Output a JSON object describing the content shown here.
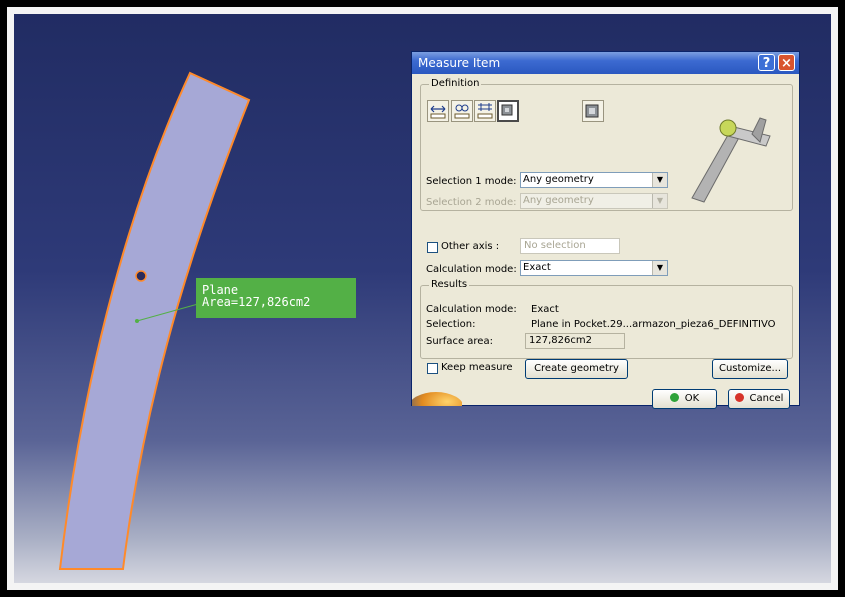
{
  "viewport": {
    "annotation": {
      "line1": "Plane",
      "line2": "Area=127,826cm2"
    },
    "colors": {
      "part_fill": "#a6a8d6",
      "part_edge": "#ff8a2a",
      "callout_bg": "#53b046"
    }
  },
  "dialog": {
    "title": "Measure Item",
    "help_icon": "question-mark",
    "close_icon": "close-x",
    "definition": {
      "legend": "Definition",
      "tool_icons": [
        "measure-between-icon",
        "measure-between-chain-icon",
        "measure-between-fan-icon",
        "measure-item-icon",
        "measure-thickness-icon"
      ],
      "selection1_label": "Selection 1 mode:",
      "selection1_value": "Any geometry",
      "selection2_label": "Selection 2 mode:",
      "selection2_value": "Any geometry",
      "other_axis_label": "Other axis :",
      "other_axis_placeholder": "No selection",
      "calc_label": "Calculation mode:",
      "calc_value": "Exact"
    },
    "results": {
      "legend": "Results",
      "calc_label": "Calculation mode:",
      "calc_value": "Exact",
      "selection_label": "Selection:",
      "selection_value": "Plane in Pocket.29...armazon_pieza6_DEFINITIVO",
      "surface_label": "Surface area:",
      "surface_value": "127,826cm2"
    },
    "keep_measure_label": "Keep measure",
    "create_geometry_label": "Create geometry",
    "customize_label": "Customize...",
    "ok_label": "OK",
    "cancel_label": "Cancel"
  }
}
